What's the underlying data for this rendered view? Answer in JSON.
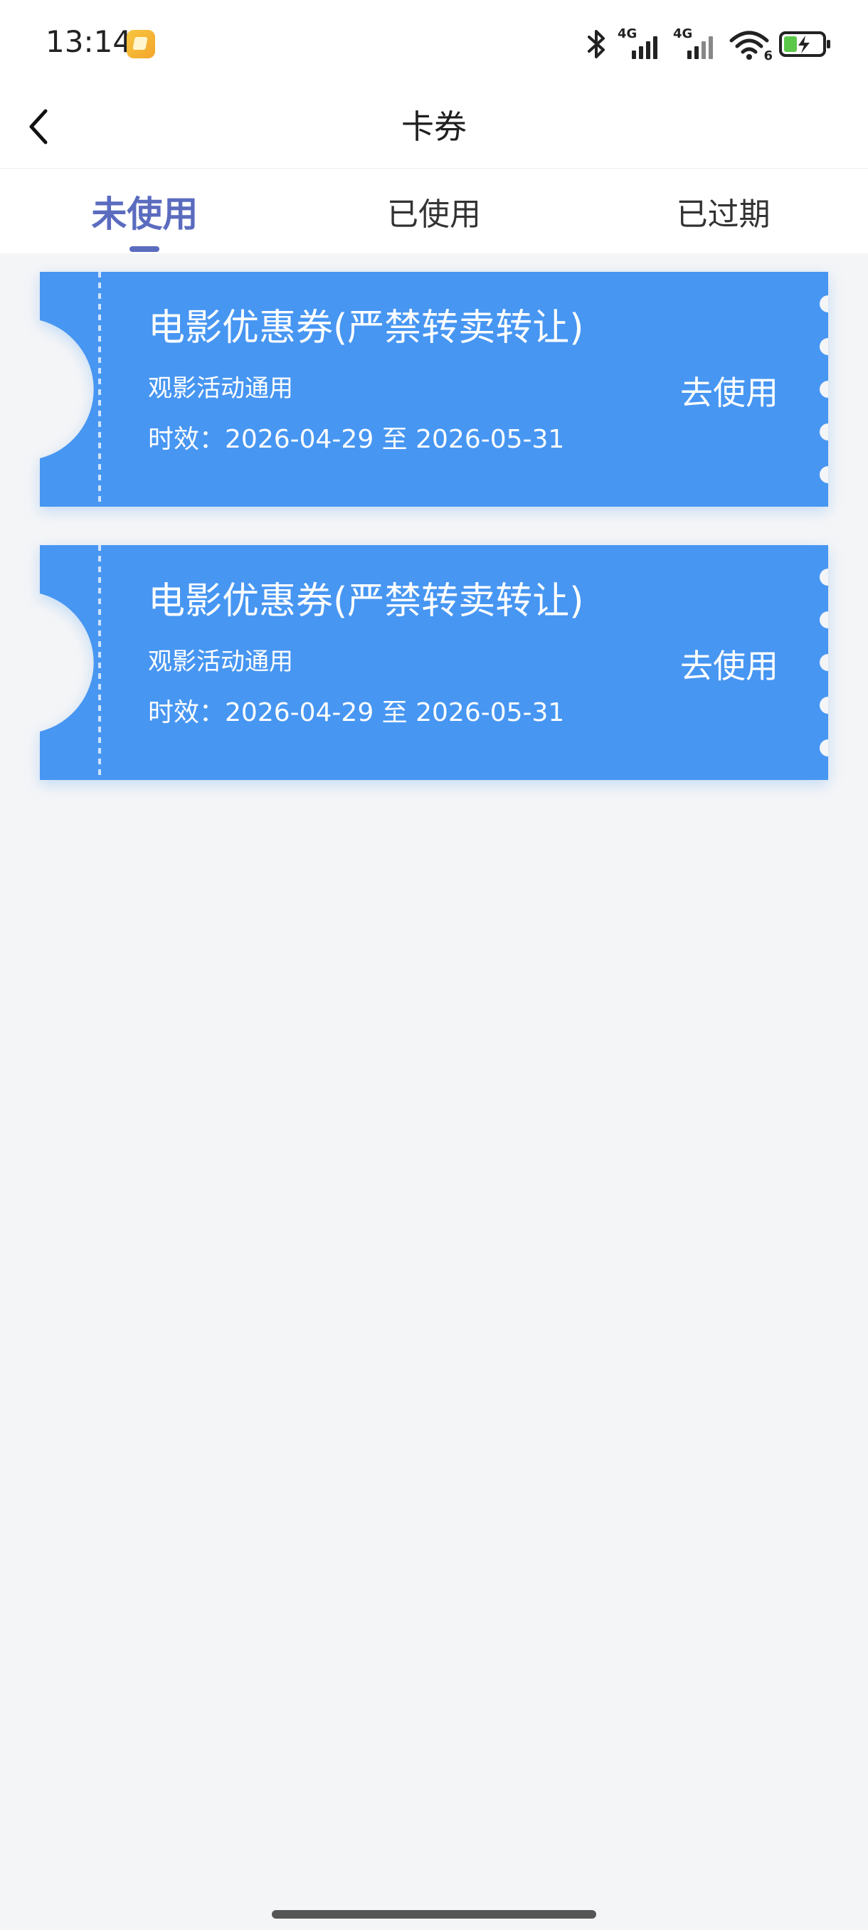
{
  "status_bar": {
    "time": "13:14",
    "network_1": "4G",
    "network_2": "4G",
    "wifi_badge": "6"
  },
  "nav": {
    "title": "卡券"
  },
  "tabs": [
    {
      "label": "未使用",
      "active": true
    },
    {
      "label": "已使用",
      "active": false
    },
    {
      "label": "已过期",
      "active": false
    }
  ],
  "coupons": [
    {
      "title": "电影优惠券(严禁转卖转让)",
      "subtitle": "观影活动通用",
      "validity_label": "时效：",
      "validity": "2026-04-29 至 2026-05-31",
      "action": "去使用"
    },
    {
      "title": "电影优惠券(严禁转卖转让)",
      "subtitle": "观影活动通用",
      "validity_label": "时效：",
      "validity": "2026-04-29 至 2026-05-31",
      "action": "去使用"
    }
  ],
  "colors": {
    "coupon_blue": "#4796f2",
    "tab_active": "#5b6cbf",
    "page_bg": "#f4f5f7"
  }
}
